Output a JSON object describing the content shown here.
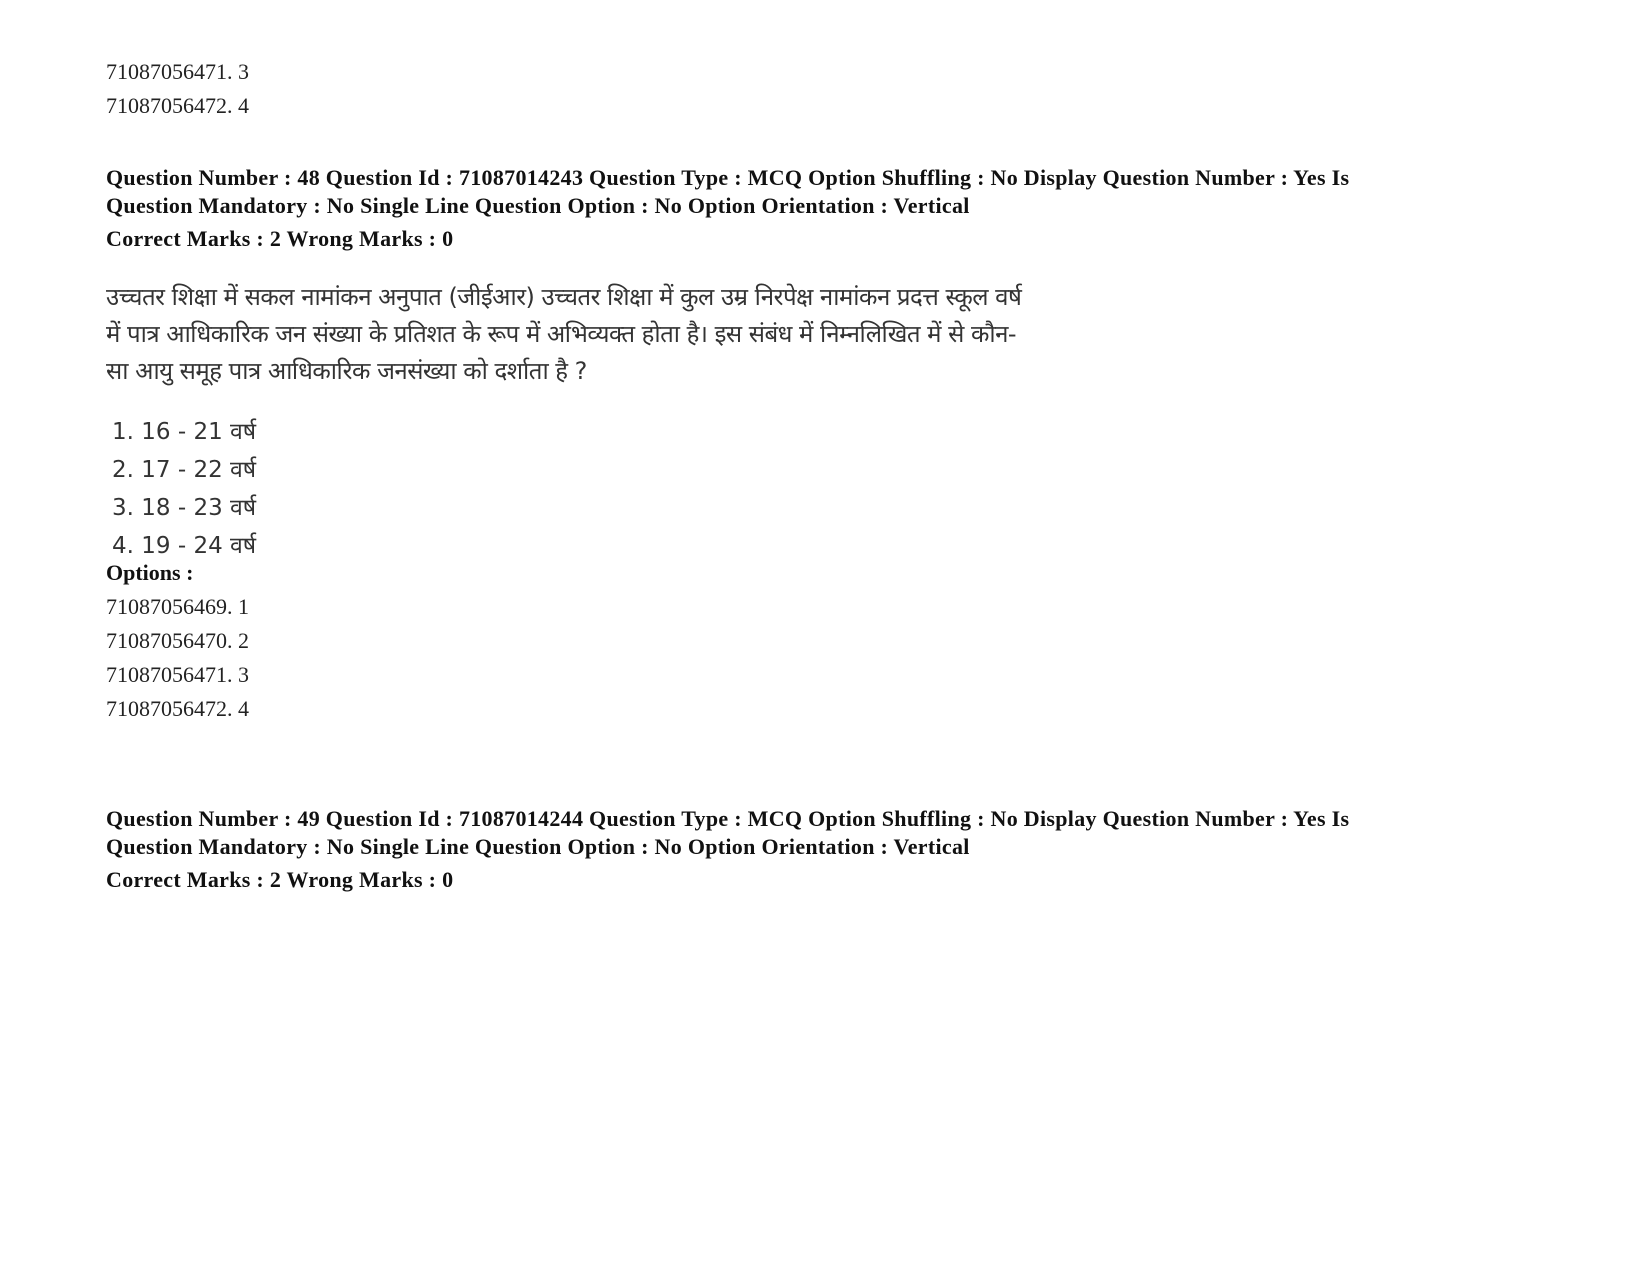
{
  "carryover_options": [
    {
      "id": "71087056471",
      "num": "3",
      "text": "71087056471. 3"
    },
    {
      "id": "71087056472",
      "num": "4",
      "text": "71087056472. 4"
    }
  ],
  "questions": [
    {
      "meta_line1": "Question Number : 48 Question Id : 71087014243 Question Type : MCQ Option Shuffling : No Display Question Number : Yes Is",
      "meta_line2": "Question Mandatory : No Single Line Question Option : No Option Orientation : Vertical",
      "marks": "Correct Marks : 2 Wrong Marks : 0",
      "text_lines": [
        "उच्चतर शिक्षा में सकल नामांकन अनुपात (जीईआर) उच्चतर शिक्षा में कुल उम्र निरपेक्ष नामांकन प्रदत्त स्कूल वर्ष",
        "में पात्र आधिकारिक जन संख्या के प्रतिशत के रूप में अभिव्यक्त होता है। इस संबंध में निम्नलिखित में से कौन-",
        "सा आयु समूह पात्र  आधिकारिक जनसंख्या को दर्शाता है ?"
      ],
      "choices": [
        "1. 16 - 21 वर्ष",
        "2. 17 - 22 वर्ष",
        "3. 18 - 23 वर्ष",
        "4. 19 - 24 वर्ष"
      ],
      "options_label": "Options :",
      "options": [
        "71087056469. 1",
        "71087056470. 2",
        "71087056471. 3",
        "71087056472. 4"
      ]
    },
    {
      "meta_line1": "Question Number : 49 Question Id : 71087014244 Question Type : MCQ Option Shuffling : No Display Question Number : Yes Is",
      "meta_line2": "Question Mandatory : No Single Line Question Option : No Option Orientation : Vertical",
      "marks": "Correct Marks : 2 Wrong Marks : 0"
    }
  ]
}
